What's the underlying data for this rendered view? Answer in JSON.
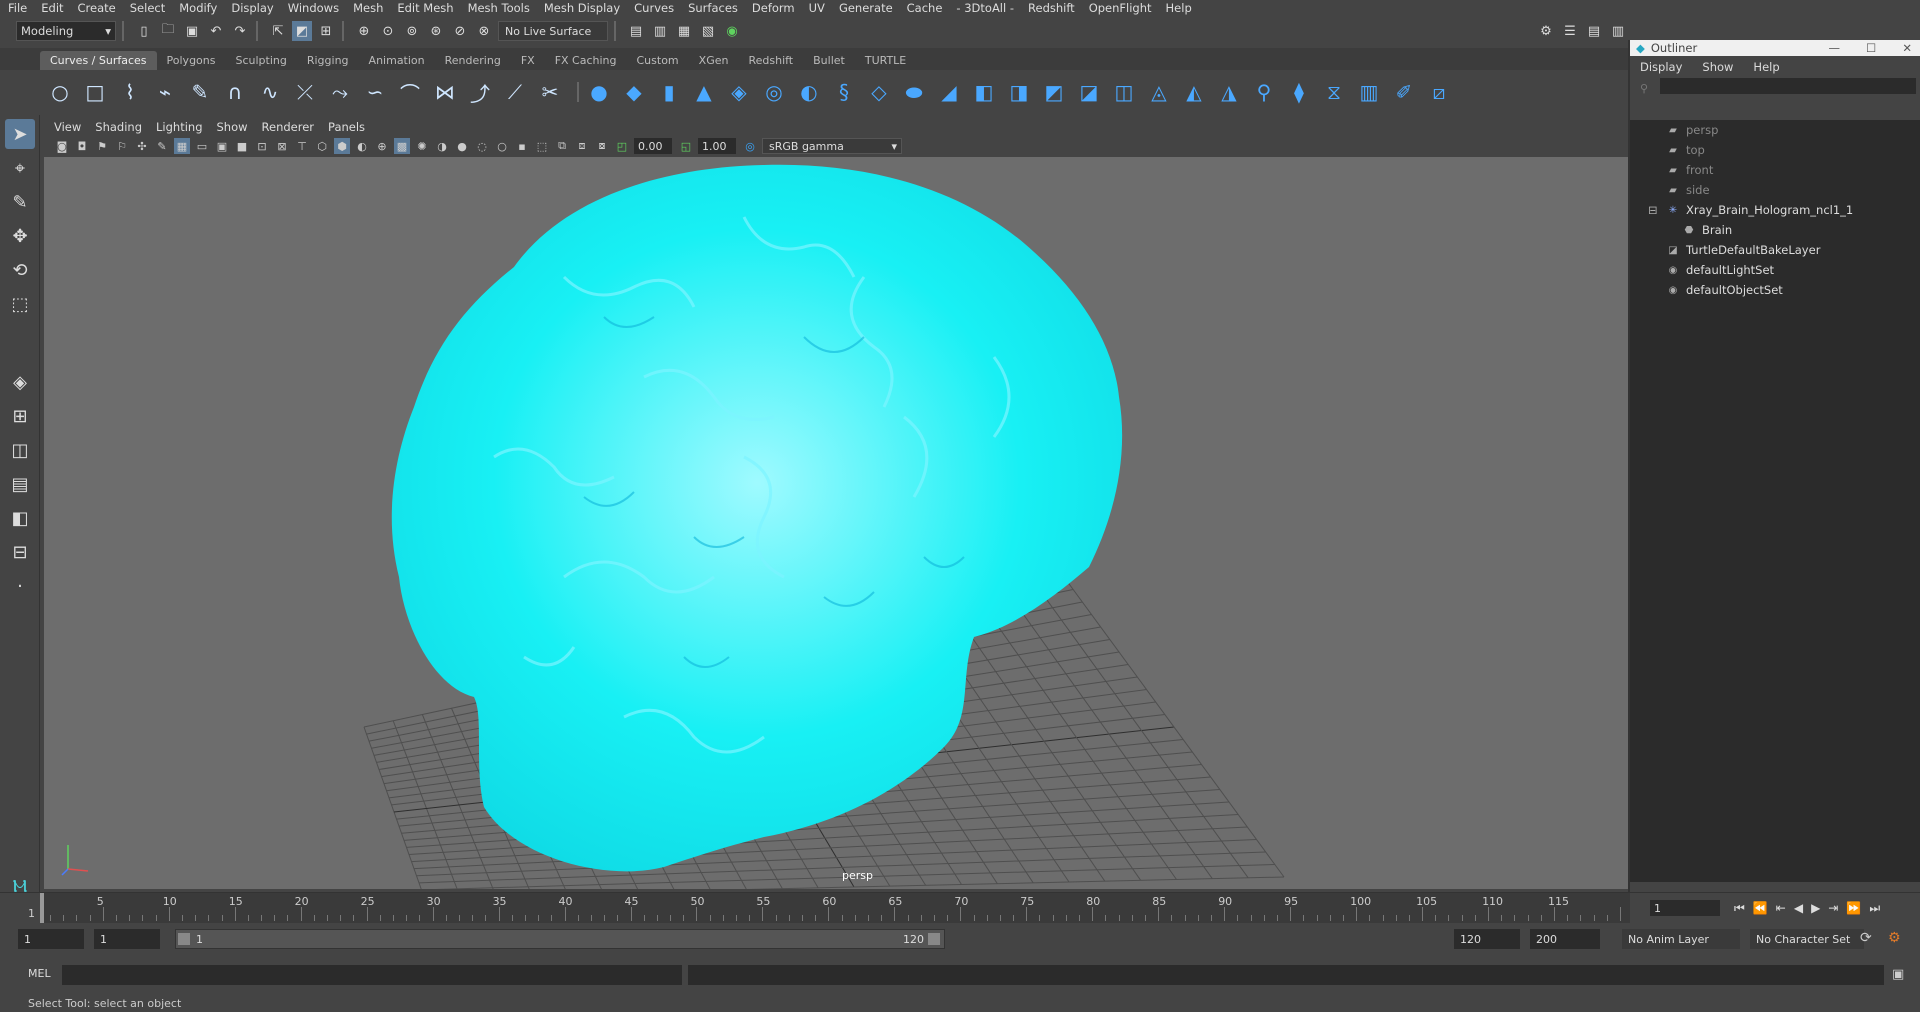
{
  "menubar": [
    "File",
    "Edit",
    "Create",
    "Select",
    "Modify",
    "Display",
    "Windows",
    "Mesh",
    "Edit Mesh",
    "Mesh Tools",
    "Mesh Display",
    "Curves",
    "Surfaces",
    "Deform",
    "UV",
    "Generate",
    "Cache",
    "- 3DtoAll -",
    "Redshift",
    "OpenFlight",
    "Help"
  ],
  "toolbar": {
    "mode": "Modeling",
    "live_surface": "No Live Surface"
  },
  "shelf_tabs": [
    "Curves / Surfaces",
    "Polygons",
    "Sculpting",
    "Rigging",
    "Animation",
    "Rendering",
    "FX",
    "FX Caching",
    "Custom",
    "XGen",
    "Redshift",
    "Bullet",
    "TURTLE"
  ],
  "viewport": {
    "menu": [
      "View",
      "Shading",
      "Lighting",
      "Show",
      "Renderer",
      "Panels"
    ],
    "exposure": "0.00",
    "gamma_value": "1.00",
    "color_space": "sRGB gamma",
    "camera": "persp",
    "brain_color": "#16f2f2",
    "bg_color": "#6d6d6d"
  },
  "outliner": {
    "title": "Outliner",
    "menu": [
      "Display",
      "Show",
      "Help"
    ],
    "items": [
      {
        "label": "persp",
        "icon": "camera-icon",
        "dim": true
      },
      {
        "label": "top",
        "icon": "camera-icon",
        "dim": true
      },
      {
        "label": "front",
        "icon": "camera-icon",
        "dim": true
      },
      {
        "label": "side",
        "icon": "camera-icon",
        "dim": true
      },
      {
        "label": "Xray_Brain_Hologram_ncl1_1",
        "icon": "group-icon",
        "dim": false
      },
      {
        "label": "Brain",
        "icon": "mesh-icon",
        "dim": false
      },
      {
        "label": "TurtleDefaultBakeLayer",
        "icon": "layer-icon",
        "dim": false
      },
      {
        "label": "defaultLightSet",
        "icon": "set-icon",
        "dim": false
      },
      {
        "label": "defaultObjectSet",
        "icon": "set-icon",
        "dim": false
      }
    ]
  },
  "timeline": {
    "ticks": [
      "5",
      "10",
      "15",
      "20",
      "25",
      "30",
      "35",
      "40",
      "45",
      "50",
      "55",
      "60",
      "65",
      "70",
      "75",
      "80",
      "85",
      "90",
      "95",
      "100",
      "105",
      "110",
      "115"
    ],
    "current_frame": "1",
    "start_marker": "1"
  },
  "range": {
    "start": "1",
    "playback_start": "1",
    "slider_start": "1",
    "slider_end": "120",
    "playback_end": "120",
    "end": "200",
    "anim_layer": "No Anim Layer",
    "character_set": "No Character Set"
  },
  "command": {
    "lang": "MEL"
  },
  "help_line": "Select Tool: select an object"
}
